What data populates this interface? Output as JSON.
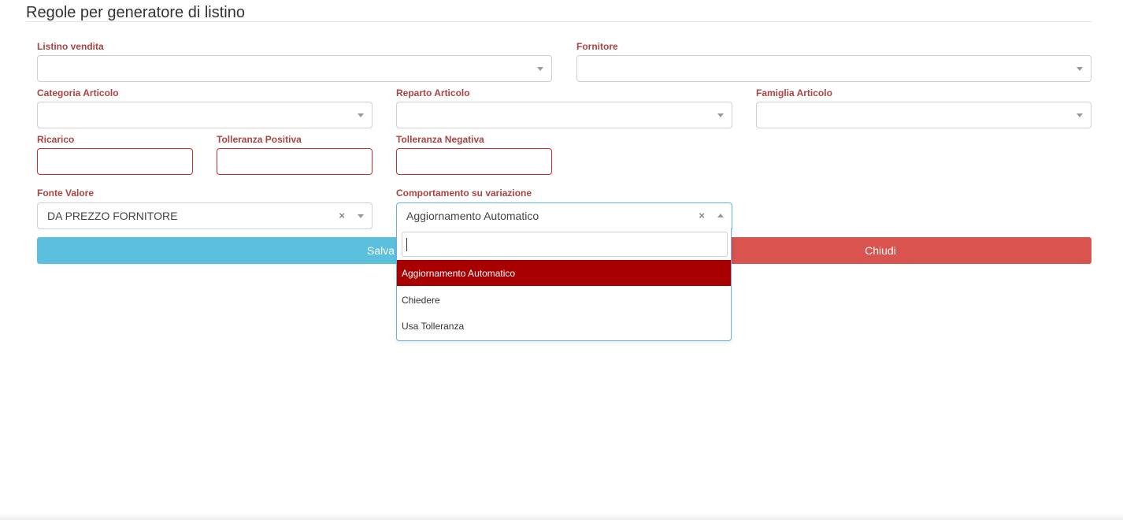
{
  "page": {
    "title": "Regole per generatore di listino"
  },
  "fields": {
    "listino_vendita": {
      "label": "Listino vendita",
      "value": ""
    },
    "fornitore": {
      "label": "Fornitore",
      "value": ""
    },
    "categoria_articolo": {
      "label": "Categoria Articolo",
      "value": ""
    },
    "reparto_articolo": {
      "label": "Reparto Articolo",
      "value": ""
    },
    "famiglia_articolo": {
      "label": "Famiglia Articolo",
      "value": ""
    },
    "ricarico": {
      "label": "Ricarico",
      "value": ""
    },
    "tolleranza_positiva": {
      "label": "Tolleranza Positiva",
      "value": ""
    },
    "tolleranza_negativa": {
      "label": "Tolleranza Negativa",
      "value": ""
    },
    "fonte_valore": {
      "label": "Fonte Valore",
      "value": "DA PREZZO FORNITORE"
    },
    "comportamento": {
      "label": "Comportamento su variazione",
      "value": "Aggiornamento Automatico"
    }
  },
  "dropdown": {
    "search_value": "",
    "options": [
      "Aggiornamento Automatico",
      "Chiedere",
      "Usa Tolleranza"
    ],
    "highlighted": "Aggiornamento Automatico"
  },
  "buttons": {
    "save": "Salva",
    "close": "Chiudi"
  },
  "colors": {
    "label": "#a94442",
    "save": "#5bc0de",
    "close": "#d9534f",
    "highlight": "#a80000"
  },
  "icons": {
    "clear": "×"
  }
}
